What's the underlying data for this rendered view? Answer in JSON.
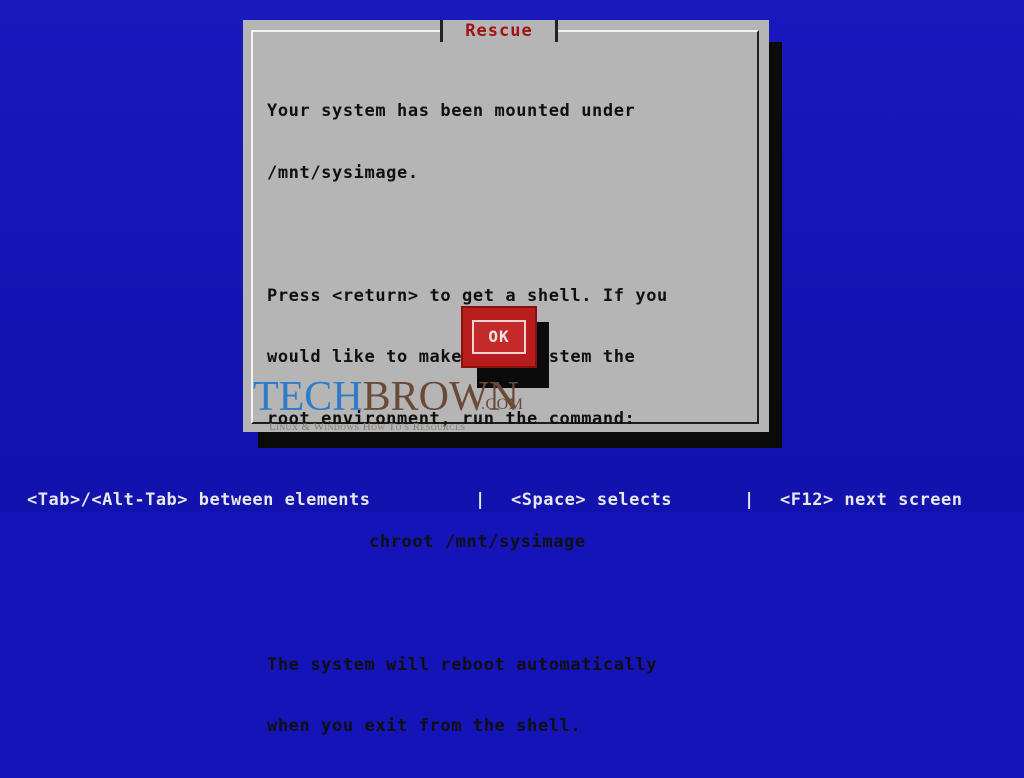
{
  "dialog": {
    "title": "Rescue",
    "message_lines": [
      "Your system has been mounted under",
      "/mnt/sysimage.",
      "",
      "Press <return> to get a shell. If you",
      "would like to make your system the",
      "root environment, run the command:",
      "",
      "chroot /mnt/sysimage",
      "",
      "The system will reboot automatically",
      "when you exit from the shell."
    ],
    "ok_label": "OK"
  },
  "watermark": {
    "tech": "TECH",
    "brown": "BROWN",
    "tld": ".COM",
    "tagline": "Linux & Windows How To's Resources"
  },
  "statusbar": {
    "items": [
      "<Tab>/<Alt-Tab> between elements",
      "<Space> selects",
      "<F12> next screen"
    ],
    "separator": "|"
  },
  "colors": {
    "background": "#1414b8",
    "dialog": "#b5b5b5",
    "title_text": "#a11212",
    "button": "#b81d1d",
    "statusbar_text": "#e8e8e8"
  }
}
